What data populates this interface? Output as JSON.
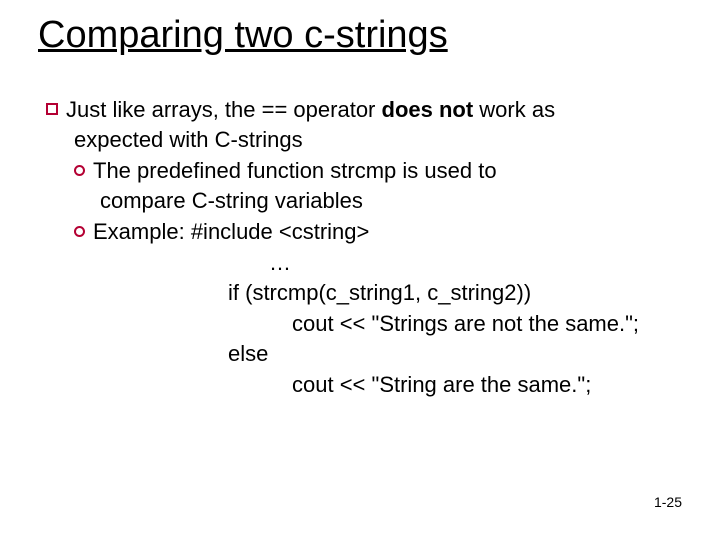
{
  "title": "Comparing two c-strings",
  "p1a": "Just like arrays, the == operator ",
  "p1b": "does not",
  "p1c": " work as",
  "p2": "expected with C-strings",
  "s1a": "The predefined function strcmp is used to",
  "s1b": "compare C-string variables",
  "s2": "Example: #include <cstring>",
  "c1": "…",
  "c2": "if (strcmp(c_string1, c_string2))",
  "c3": "cout << \"Strings are not the same.\";",
  "c4": "else",
  "c5": "cout << \"String are the same.\";",
  "footer": "1-25"
}
